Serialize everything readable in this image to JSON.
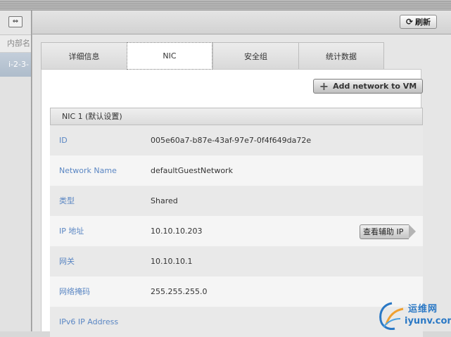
{
  "left_panel": {
    "expand_icon": "expand-horizontal-icon",
    "column_header": "内部名",
    "row_value": "i-2-3-"
  },
  "toolbar": {
    "refresh_label": "刷新",
    "refresh_icon": "refresh-icon"
  },
  "tabs": [
    {
      "label": "详细信息",
      "active": false
    },
    {
      "label": "NIC",
      "active": true
    },
    {
      "label": "安全组",
      "active": false
    },
    {
      "label": "统计数据",
      "active": false
    }
  ],
  "add_network_button": "Add network to VM",
  "nic": {
    "header": "NIC 1 (默认设置)",
    "rows": [
      {
        "label": "ID",
        "value": "005e60a7-b87e-43af-97e7-0f4f649da72e"
      },
      {
        "label": "Network Name",
        "value": "defaultGuestNetwork"
      },
      {
        "label": "类型",
        "value": "Shared"
      },
      {
        "label": "IP 地址",
        "value": "10.10.10.203",
        "action": "查看辅助 IP"
      },
      {
        "label": "网关",
        "value": "10.10.10.1"
      },
      {
        "label": "网络掩码",
        "value": "255.255.255.0"
      },
      {
        "label": "IPv6 IP Address",
        "value": ""
      }
    ]
  },
  "watermark": {
    "line1": "运维网",
    "line2": "iyunv.com"
  },
  "colors": {
    "label_blue": "#5a86c3",
    "watermark_blue": "#2a78c5"
  }
}
